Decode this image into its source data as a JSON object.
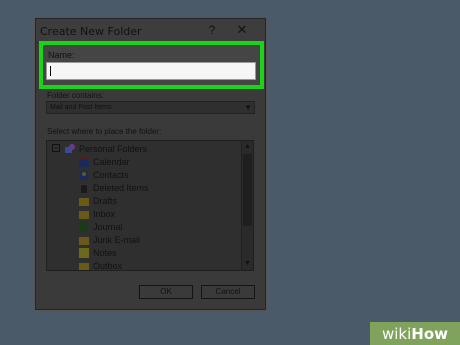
{
  "dialog": {
    "title": "Create New Folder",
    "help_label": "?",
    "close_label": "✕"
  },
  "name_field": {
    "label": "Name:",
    "value": ""
  },
  "folder_contains": {
    "label": "Folder contains:",
    "selected": "Mail and Post Items"
  },
  "place": {
    "label": "Select where to place the folder:",
    "root": "Personal Folders",
    "items": [
      {
        "label": "Calendar",
        "icon": "calendar-icon"
      },
      {
        "label": "Contacts",
        "icon": "contacts-icon"
      },
      {
        "label": "Deleted Items",
        "icon": "deleted-items-icon"
      },
      {
        "label": "Drafts",
        "icon": "drafts-icon"
      },
      {
        "label": "Inbox",
        "icon": "inbox-icon"
      },
      {
        "label": "Journal",
        "icon": "journal-icon"
      },
      {
        "label": "Junk E-mail",
        "icon": "junk-email-icon"
      },
      {
        "label": "Notes",
        "icon": "notes-icon"
      },
      {
        "label": "Outbox",
        "icon": "outbox-icon"
      }
    ]
  },
  "buttons": {
    "ok": "OK",
    "cancel": "Cancel"
  },
  "watermark": {
    "prefix": "wiki",
    "suffix": "How"
  },
  "colors": {
    "highlight": "#19d419",
    "background": "#4b5a68",
    "dialog": "#3a3a3a"
  }
}
